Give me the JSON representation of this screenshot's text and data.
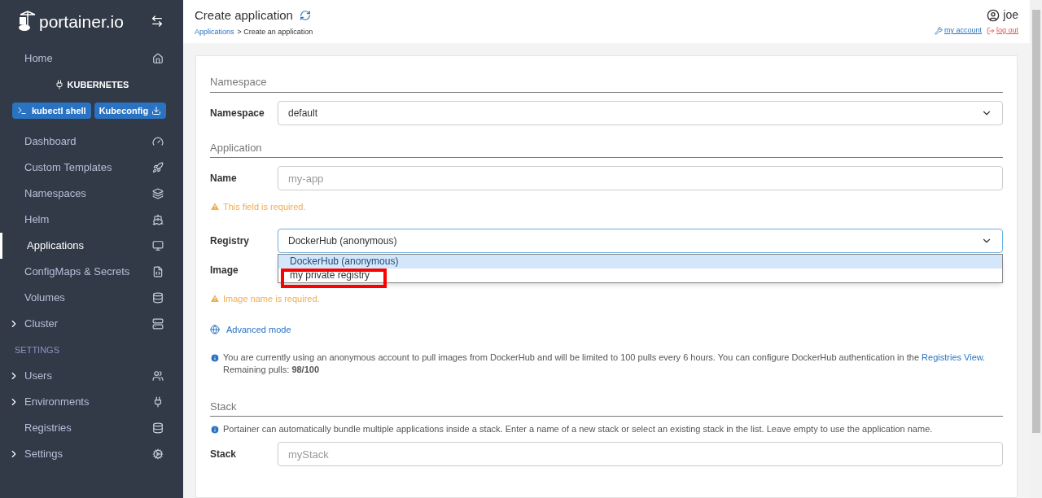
{
  "sidebar": {
    "logo": "portainer.io",
    "home": {
      "label": "Home",
      "selected": false
    },
    "environment": {
      "name": "KUBERNETES",
      "buttons": [
        "kubectl shell",
        "Kubeconfig"
      ],
      "items": [
        {
          "label": "Dashboard",
          "selected": false,
          "expandable": false
        },
        {
          "label": "Custom Templates",
          "selected": false,
          "expandable": false
        },
        {
          "label": "Namespaces",
          "selected": false,
          "expandable": false
        },
        {
          "label": "Helm",
          "selected": false,
          "expandable": false
        },
        {
          "label": "Applications",
          "selected": true,
          "expandable": false
        },
        {
          "label": "ConfigMaps & Secrets",
          "selected": false,
          "expandable": false
        },
        {
          "label": "Volumes",
          "selected": false,
          "expandable": false
        },
        {
          "label": "Cluster",
          "selected": false,
          "expandable": true
        }
      ]
    },
    "settings": {
      "title": "SETTINGS",
      "items": [
        {
          "label": "Users",
          "selected": false,
          "expandable": true
        },
        {
          "label": "Environments",
          "selected": false,
          "expandable": true
        },
        {
          "label": "Registries",
          "selected": false,
          "expandable": false
        },
        {
          "label": "Settings",
          "selected": false,
          "expandable": true
        }
      ]
    }
  },
  "header": {
    "title": "Create application",
    "breadcrumb": {
      "link": "Applications",
      "current": "> Create an application"
    },
    "user": "joe",
    "account_link": "my account",
    "logout_link": "log out"
  },
  "form": {
    "namespace_section": "Namespace",
    "namespace": {
      "label": "Namespace",
      "value": "default"
    },
    "application_section": "Application",
    "name": {
      "label": "Name",
      "placeholder": "my-app",
      "warning": "This field is required."
    },
    "registry": {
      "label": "Registry",
      "value": "DockerHub (anonymous)",
      "expanded": true,
      "options": [
        {
          "label": "DockerHub (anonymous)",
          "selected": true
        },
        {
          "label": "my private registry",
          "selected": false,
          "highlighted": true
        }
      ]
    },
    "image": {
      "label": "Image",
      "warning": "Image name is required."
    },
    "advanced_mode": "Advanced mode",
    "dockerhub_info": "You are currently using an anonymous account to pull images from DockerHub and will be limited to 100 pulls every 6 hours. You can configure DockerHub authentication in the",
    "registries_link": "Registries View",
    "remaining": ". Remaining pulls: **98/100**",
    "stack_section": "Stack",
    "stack_info": "Portainer can automatically bundle multiple applications inside a stack. Enter a name of a new stack or select an existing stack in the list. Leave empty to use the application name.",
    "stack": {
      "label": "Stack",
      "placeholder": "myStack"
    }
  }
}
